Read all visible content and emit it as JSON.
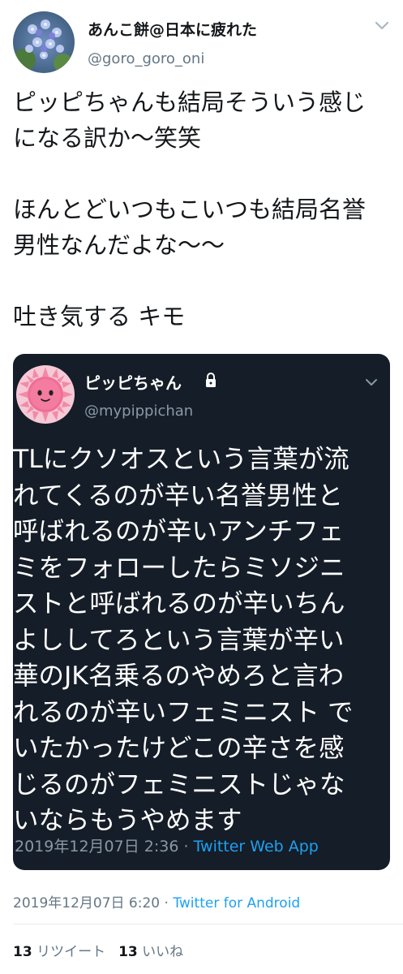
{
  "tweet": {
    "author": {
      "display_name": "あんこ餅@日本に疲れた",
      "handle": "@goro_goro_oni",
      "avatar_icon": "hydrangea-photo-avatar"
    },
    "text_lines": [
      "ピッピちゃんも結局そういう感じ",
      "になる訳か〜笑笑",
      "",
      "ほんとどいつもこいつも結局名誉",
      "男性なんだよな〜〜",
      "",
      "吐き気する キモ"
    ],
    "quoted": {
      "author": {
        "display_name": "ピッピちゃん",
        "handle": "@mypippichan",
        "avatar_icon": "pink-sun-face-avatar",
        "lock_icon": "lock-icon"
      },
      "text_lines": [
        "TLにクソオスという言葉が流",
        "れてくるのが辛い名誉男性と",
        "呼ばれるのが辛いアンチフェ",
        "ミをフォローしたらミソジニ",
        "ストと呼ばれるのが辛いちん",
        "よししてろという言葉が辛い",
        "華のJK名乗るのやめろと言わ",
        "れるのが辛いフェミニスト で",
        "いたかったけどこの辛さを感",
        "じるのがフェミニストじゃな",
        "いならもうやめます"
      ],
      "timestamp": "2019年12月07日 2:36",
      "separator": "·",
      "source": "Twitter Web App"
    },
    "timestamp": "2019年12月07日 6:20",
    "separator": "·",
    "source": "Twitter for Android",
    "stats": {
      "retweets_count": "13",
      "retweets_label": "リツイート",
      "likes_count": "13",
      "likes_label": "いいね"
    }
  },
  "colors": {
    "text_primary": "#14171a",
    "text_secondary": "#657786",
    "link": "#1da1f2",
    "quote_background": "#151d28",
    "quote_text": "#ffffff",
    "quote_secondary": "#8899a6"
  }
}
